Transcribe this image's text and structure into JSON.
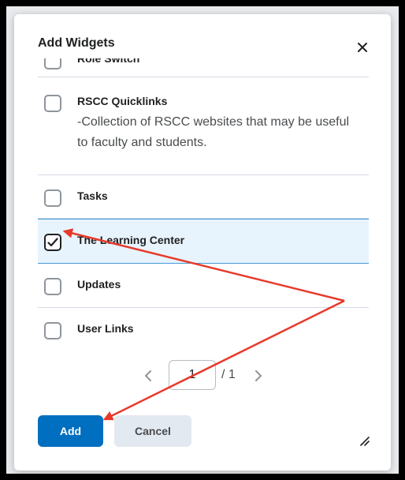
{
  "dialog": {
    "title": "Add Widgets",
    "close_icon": "close-icon"
  },
  "widgets": [
    {
      "label": "Role Switch",
      "checked": false
    },
    {
      "label": "RSCC Quicklinks",
      "description": "-Collection of RSCC websites that may be useful to faculty and students.",
      "checked": false
    },
    {
      "label": "Tasks",
      "checked": false
    },
    {
      "label": "The Learning Center",
      "checked": true
    },
    {
      "label": "Updates",
      "checked": false
    },
    {
      "label": "User Links",
      "checked": false
    }
  ],
  "pagination": {
    "current": "1",
    "total": "/ 1",
    "prev_icon": "chevron-left-icon",
    "next_icon": "chevron-right-icon"
  },
  "buttons": {
    "add": "Add",
    "cancel": "Cancel"
  },
  "colors": {
    "primary": "#006fbf",
    "selected_bg": "#e8f4fd",
    "selected_border": "#3f9bd8",
    "annotation_arrow": "#e8392b"
  }
}
